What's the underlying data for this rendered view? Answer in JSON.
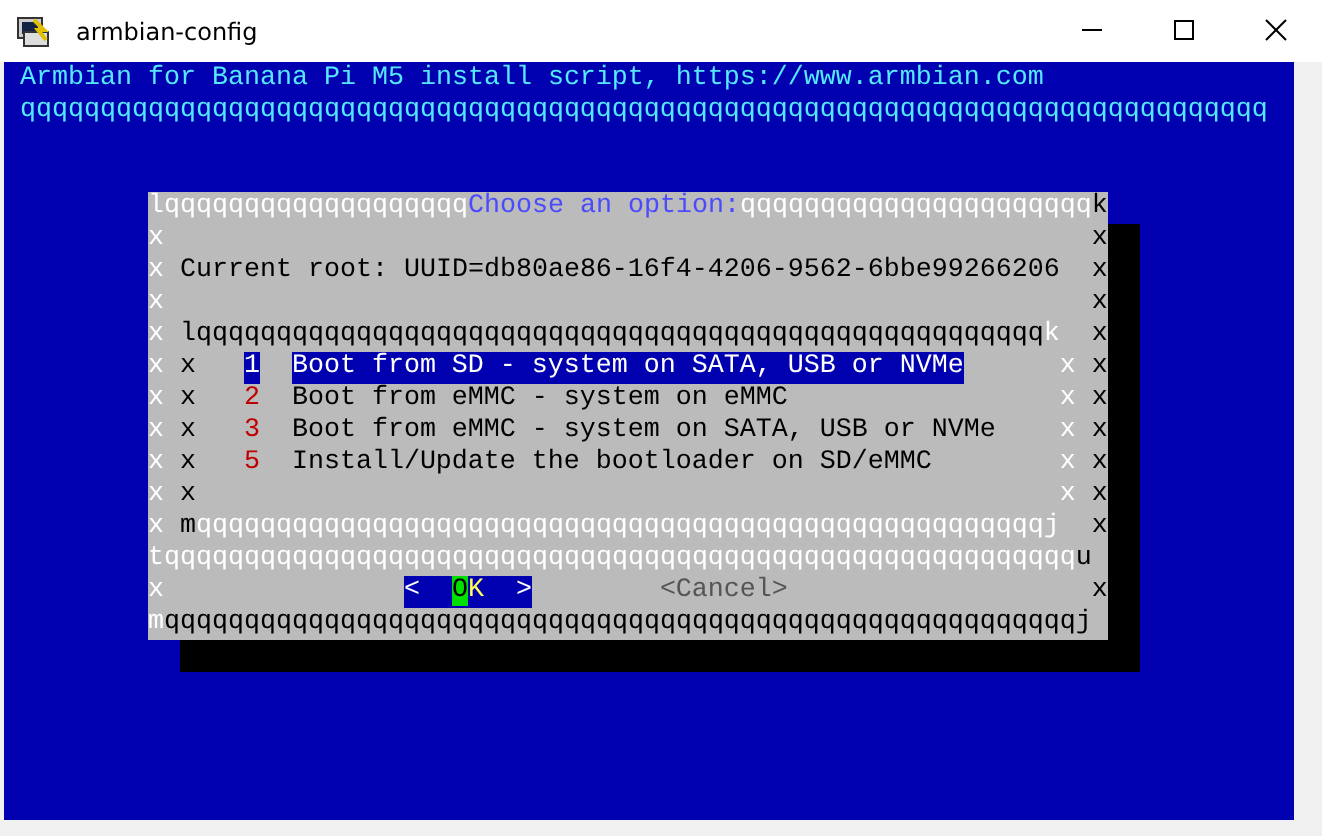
{
  "window": {
    "title": "armbian-config"
  },
  "header": {
    "title": "Armbian for Banana Pi M5 install script, https://www.armbian.com",
    "rule": "qqqqqqqqqqqqqqqqqqqqqqqqqqqqqqqqqqqqqqqqqqqqqqqqqqqqqqqqqqqqqqqqqqqqqqqqqqqqqq"
  },
  "dialog": {
    "rows": [
      {
        "kind": "title",
        "left": "lqqqqqqqqqqqqqqqqqqq",
        "title": "Choose an option:",
        "right": "qqqqqqqqqqqqqqqqqqqqqqk"
      },
      {
        "kind": "blank",
        "left": "x",
        "right": "x"
      },
      {
        "kind": "text",
        "left": "x",
        "text": "Current root: UUID=db80ae86-16f4-4206-9562-6bbe99266206",
        "right": "x"
      },
      {
        "kind": "blank",
        "left": "x",
        "right": "x"
      },
      {
        "kind": "box_top",
        "left": "x",
        "inner": "lqqqqqqqqqqqqqqqqqqqqqqqqqqqqqqqqqqqqqqqqqqqqqqqqqqqqqk",
        "right": "x"
      },
      {
        "kind": "item",
        "left": "x",
        "inner_left": "x",
        "tag": "1",
        "label": "Boot from SD - system on SATA, USB or NVMe",
        "inner_right": "x",
        "right": "x",
        "selected": true
      },
      {
        "kind": "item",
        "left": "x",
        "inner_left": "x",
        "tag": "2",
        "label": "Boot from eMMC - system on eMMC",
        "inner_right": "x",
        "right": "x",
        "selected": false
      },
      {
        "kind": "item",
        "left": "x",
        "inner_left": "x",
        "tag": "3",
        "label": "Boot from eMMC - system on SATA, USB or NVMe",
        "inner_right": "x",
        "right": "x",
        "selected": false
      },
      {
        "kind": "item",
        "left": "x",
        "inner_left": "x",
        "tag": "5",
        "label": "Install/Update the bootloader on SD/eMMC",
        "inner_right": "x",
        "right": "x",
        "selected": false
      },
      {
        "kind": "box_blank",
        "left": "x",
        "inner_left": "x",
        "inner_right": "x",
        "right": "x"
      },
      {
        "kind": "box_bottom",
        "left": "x",
        "inner": "mqqqqqqqqqqqqqqqqqqqqqqqqqqqqqqqqqqqqqqqqqqqqqqqqqqqqqj",
        "right": "x"
      },
      {
        "kind": "separator",
        "text": "tqqqqqqqqqqqqqqqqqqqqqqqqqqqqqqqqqqqqqqqqqqqqqqqqqqqqqqqqqu"
      },
      {
        "kind": "buttons",
        "left": "x",
        "buttons": [
          {
            "label": "<  OK  >",
            "selected": true
          },
          {
            "label": "<Cancel>",
            "selected": false
          }
        ],
        "right": "x"
      },
      {
        "kind": "bottom",
        "text": "mqqqqqqqqqqqqqqqqqqqqqqqqqqqqqqqqqqqqqqqqqqqqqqqqqqqqqqqqqj"
      }
    ]
  }
}
